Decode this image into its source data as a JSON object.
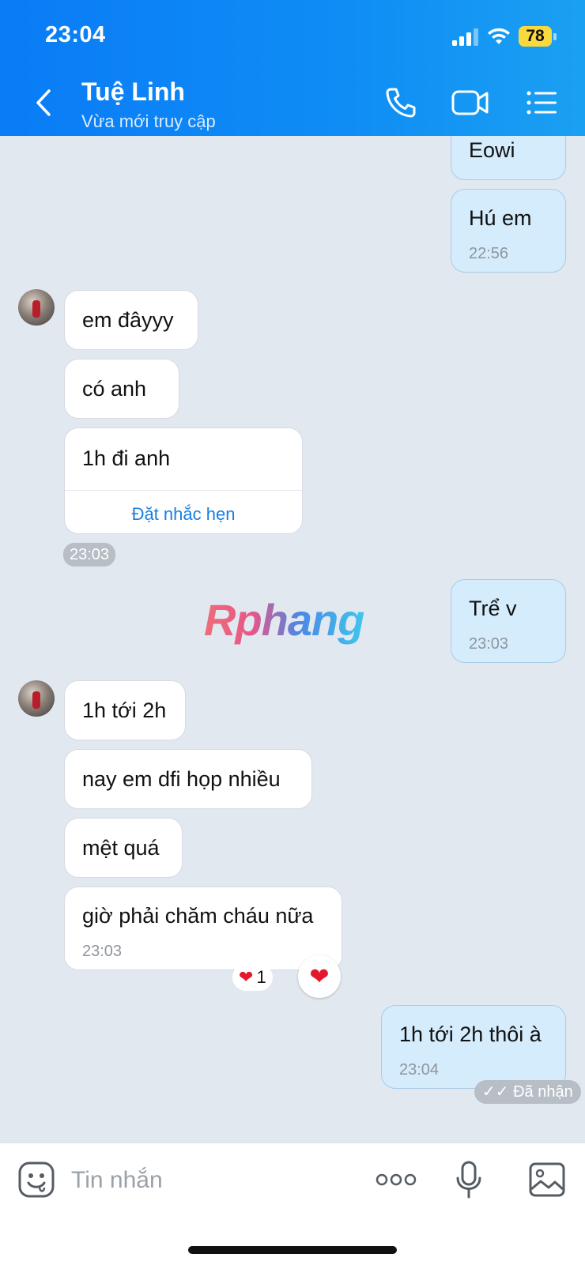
{
  "status_bar": {
    "time": "23:04",
    "battery": "78"
  },
  "header": {
    "name": "Tuệ Linh",
    "status": "Vừa mới truy cập"
  },
  "watermark": "Rphang",
  "messages": {
    "m1": {
      "text": "Eowi"
    },
    "m2": {
      "text": "Hú em",
      "time": "22:56"
    },
    "m3": {
      "text": "em đâyyy"
    },
    "m4": {
      "text": "có anh"
    },
    "m5": {
      "text": "1h đi anh",
      "action": "Đặt nhắc hẹn"
    },
    "group1_time": "23:03",
    "m6": {
      "text": "Trể v",
      "time": "23:03"
    },
    "m7": {
      "text": "1h tới 2h"
    },
    "m8": {
      "text": "nay em dfi họp nhiều"
    },
    "m9": {
      "text": "mệt quá"
    },
    "m10": {
      "text": "giờ phải chăm cháu nữa",
      "time": "23:03"
    },
    "reaction": {
      "count": "1",
      "emoji": "❤️"
    },
    "m11": {
      "text": "1h tới 2h thôi à",
      "time": "23:04"
    },
    "received": "Đã nhận"
  },
  "input": {
    "placeholder": "Tin nhắn"
  },
  "colors": {
    "header": "#0a7cf6",
    "outgoing_bubble": "#d4ecfb",
    "incoming_bubble": "#ffffff",
    "chat_bg": "#e2e8ef",
    "link": "#1a7fe0"
  }
}
